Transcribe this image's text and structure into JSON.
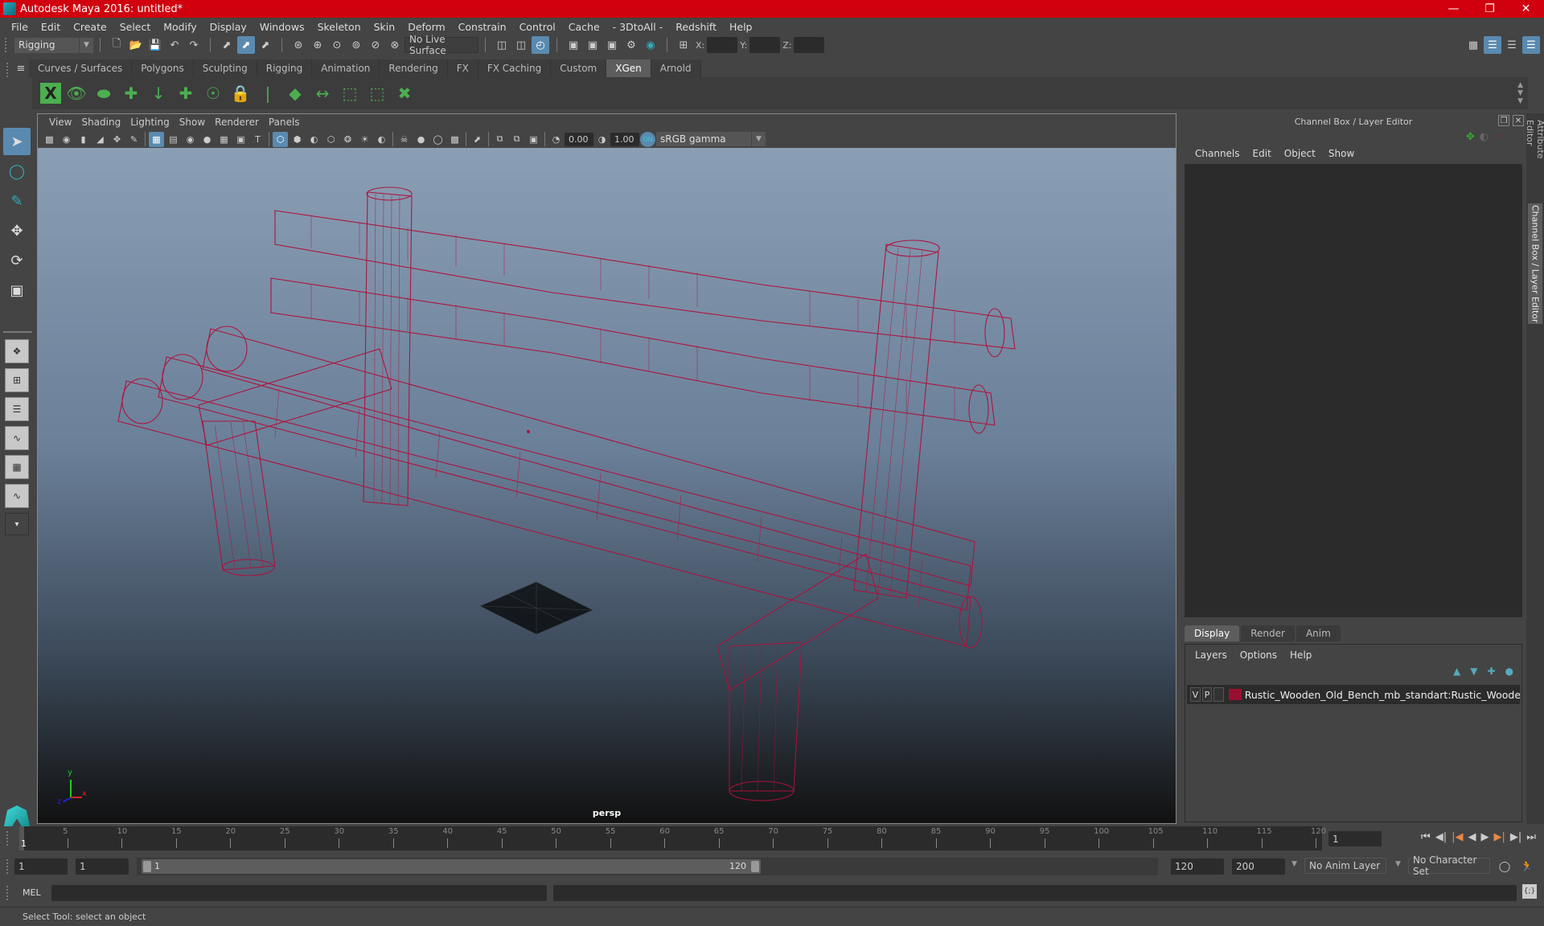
{
  "window": {
    "title": "Autodesk Maya 2016: untitled*",
    "controls": [
      "minimize",
      "restore",
      "close"
    ]
  },
  "menubar": [
    "File",
    "Edit",
    "Create",
    "Select",
    "Modify",
    "Display",
    "Windows",
    "Skeleton",
    "Skin",
    "Deform",
    "Constrain",
    "Control",
    "Cache",
    "- 3DtoAll -",
    "Redshift",
    "Help"
  ],
  "statusline": {
    "menuset": "Rigging",
    "live_surface": "No Live Surface",
    "x_label": "X:",
    "y_label": "Y:",
    "z_label": "Z:",
    "x_value": "",
    "y_value": "",
    "z_value": ""
  },
  "shelf": {
    "tabs": [
      "Curves / Surfaces",
      "Polygons",
      "Sculpting",
      "Rigging",
      "Animation",
      "Rendering",
      "FX",
      "FX Caching",
      "Custom",
      "XGen",
      "Arnold"
    ],
    "active_tab": "XGen",
    "icons": [
      "xgen-editor-icon",
      "xgen-preview-icon",
      "xgen-clear-preview-icon",
      "add-description-icon",
      "place-guides-icon",
      "add-guide-icon",
      "show-guides-icon",
      "lock-guides-icon",
      "split-guides-icon",
      "create-patch-icon",
      "transfer-icon",
      "select-guides-icon",
      "guide-bounds-icon",
      "delete-guides-icon"
    ]
  },
  "viewport": {
    "menu": [
      "View",
      "Shading",
      "Lighting",
      "Show",
      "Renderer",
      "Panels"
    ],
    "exposure": "0.00",
    "gamma": "1.00",
    "color_space": "sRGB gamma",
    "camera_label": "persp",
    "axis_labels": {
      "x": "x",
      "y": "y",
      "z": "z"
    },
    "wireframe_color": "#b0103a"
  },
  "channel_box": {
    "title": "Channel Box / Layer Editor",
    "menu": [
      "Channels",
      "Edit",
      "Object",
      "Show"
    ]
  },
  "layer_editor": {
    "tabs": [
      "Display",
      "Render",
      "Anim"
    ],
    "active_tab": "Display",
    "menu": [
      "Layers",
      "Options",
      "Help"
    ],
    "layers": [
      {
        "visible": "V",
        "playback": "P",
        "color": "#9a0f2f",
        "name": "Rustic_Wooden_Old_Bench_mb_standart:Rustic_Wooden"
      }
    ]
  },
  "side_tabs": [
    "Attribute Editor",
    "Channel Box / Layer Editor"
  ],
  "timeline": {
    "ticks": [
      "5",
      "10",
      "15",
      "20",
      "25",
      "30",
      "35",
      "40",
      "45",
      "50",
      "55",
      "60",
      "65",
      "70",
      "75",
      "80",
      "85",
      "90",
      "95",
      "100",
      "105",
      "110",
      "115",
      "120"
    ],
    "current_frame": "1",
    "current_frame_field": "1",
    "playback_buttons": [
      "go-to-start",
      "step-back-key",
      "step-back-frame",
      "play-backward",
      "play-forward",
      "step-forward-frame",
      "step-forward-key",
      "go-to-end"
    ]
  },
  "range": {
    "start": "1",
    "playback_start": "1",
    "slider_start": "1",
    "slider_end": "120",
    "playback_end": "120",
    "end": "200",
    "anim_layer": "No Anim Layer",
    "character_set": "No Character Set"
  },
  "command": {
    "label": "MEL",
    "input": "",
    "output": ""
  },
  "help_line": "Select Tool: select an object"
}
